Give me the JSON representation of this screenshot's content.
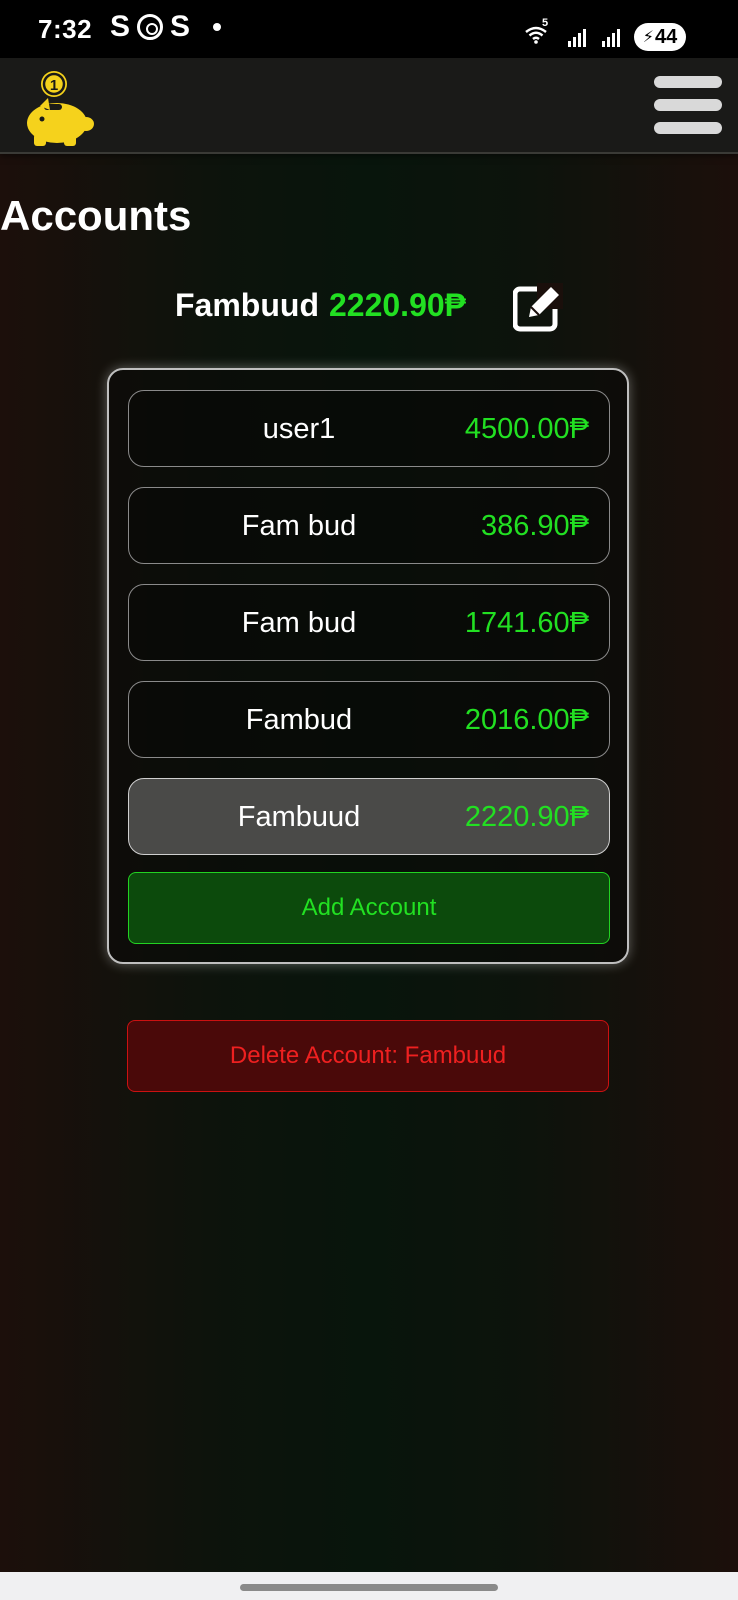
{
  "status_bar": {
    "time": "7:32",
    "app_s1": "S",
    "app_s2": "S",
    "wifi_label": "5",
    "battery": "44"
  },
  "page": {
    "title": "Accounts"
  },
  "summary": {
    "name": "Fambuud",
    "balance": "2220.90",
    "currency": "₱"
  },
  "accounts": [
    {
      "name": "user1",
      "balance": "4500.00₱",
      "selected": false
    },
    {
      "name": "Fam bud",
      "balance": "386.90₱",
      "selected": false
    },
    {
      "name": "Fam bud",
      "balance": "1741.60₱",
      "selected": false
    },
    {
      "name": "Fambud",
      "balance": "2016.00₱",
      "selected": false
    },
    {
      "name": "Fambuud",
      "balance": "2220.90₱",
      "selected": true
    }
  ],
  "buttons": {
    "add_account": "Add Account",
    "delete_account": "Delete Account: Fambuud"
  },
  "colors": {
    "positive": "#22e022",
    "danger": "#ee2020",
    "logo": "#f5d21c"
  },
  "icons": {
    "logo": "piggy-bank-coin-icon",
    "menu": "hamburger-menu-icon",
    "edit": "edit-square-icon"
  }
}
